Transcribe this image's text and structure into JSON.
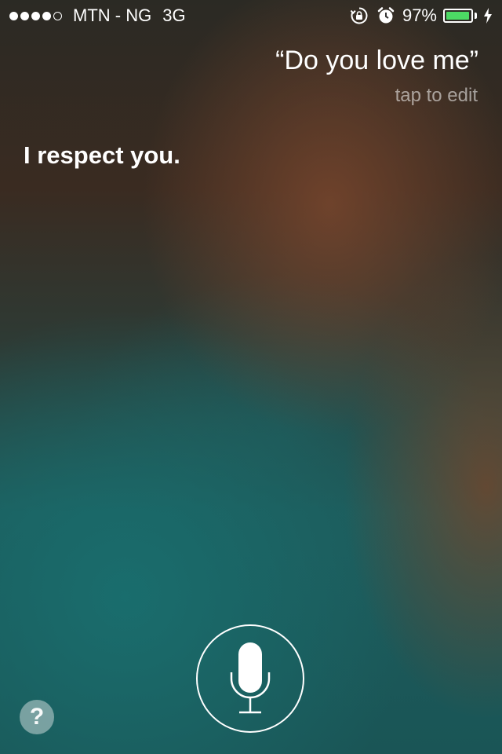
{
  "status_bar": {
    "carrier": "MTN - NG",
    "network": "3G",
    "signal_strength_bars": 4,
    "signal_total_bars": 5,
    "battery_percent_label": "97%",
    "battery_level": 0.97,
    "battery_color": "#4cd964",
    "icons": [
      "rotation-lock-icon",
      "alarm-icon",
      "battery-icon",
      "charging-bolt-icon"
    ]
  },
  "siri": {
    "query": "“Do you love me”",
    "tap_to_edit": "tap to edit",
    "response": "I respect you."
  },
  "controls": {
    "mic_icon": "microphone-icon",
    "help_label": "?"
  }
}
